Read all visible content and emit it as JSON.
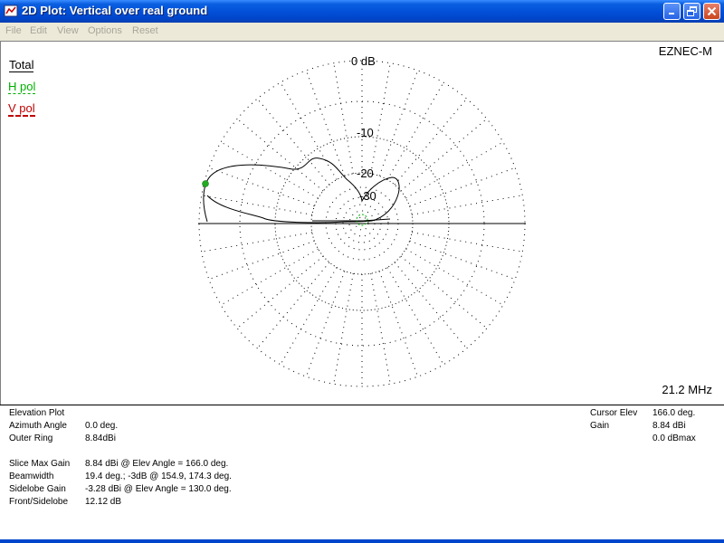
{
  "window": {
    "title": "2D Plot: Vertical over real ground",
    "buttons": [
      "minimize",
      "maximize",
      "close"
    ]
  },
  "menu": [
    "File",
    "Edit",
    "View",
    "Options",
    "Reset"
  ],
  "plot": {
    "program": "EZNEC-M",
    "frequency": "21.2 MHz",
    "legend": [
      {
        "label": "Total",
        "color": "#000000"
      },
      {
        "label": "H pol",
        "color": "#00B000"
      },
      {
        "label": "V pol",
        "color": "#C00000"
      }
    ],
    "ring_labels": [
      "0 dB",
      "-10",
      "-20",
      "-30"
    ],
    "cursor_marker_color": "#22AA22"
  },
  "info": {
    "left": [
      {
        "key": "Elevation Plot",
        "value": ""
      },
      {
        "key": "Azimuth Angle",
        "value": "0.0 deg."
      },
      {
        "key": "Outer Ring",
        "value": "8.84dBi"
      },
      {
        "key": "",
        "value": ""
      },
      {
        "key": "Slice Max Gain",
        "value": "8.84 dBi @ Elev Angle = 166.0 deg."
      },
      {
        "key": "Beamwidth",
        "value": "19.4 deg.; -3dB @ 154.9, 174.3 deg."
      },
      {
        "key": "Sidelobe Gain",
        "value": "-3.28 dBi @ Elev Angle = 130.0 deg."
      },
      {
        "key": "Front/Sidelobe",
        "value": "12.12 dB"
      }
    ],
    "right": [
      {
        "key": "Cursor Elev",
        "value": "166.0 deg."
      },
      {
        "key": "Gain",
        "value": "8.84 dBi"
      },
      {
        "key": "",
        "value": "0.0 dBmax"
      }
    ]
  }
}
